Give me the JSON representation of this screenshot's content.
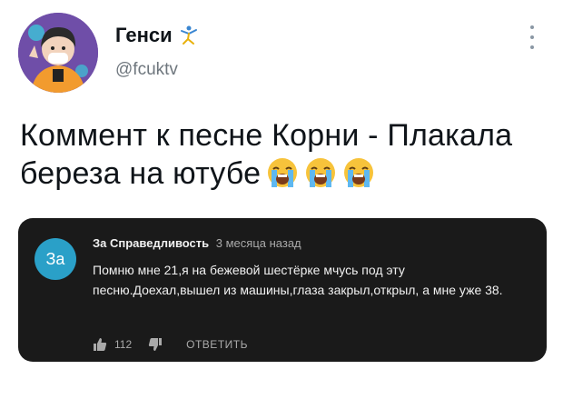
{
  "profile": {
    "display_name": "Генси",
    "handle": "@fcuktv",
    "badge_icon": "dancing-figure-emoji",
    "avatar_colors": {
      "background": "#6f4ea8",
      "hoodie": "#f29b2e",
      "hair": "#2b2b2b"
    }
  },
  "tweet": {
    "text": "Коммент к песне Корни - Плакала береза на ютубе",
    "emojis": [
      "loudly-crying-face",
      "loudly-crying-face",
      "loudly-crying-face"
    ]
  },
  "comment": {
    "avatar_text": "За",
    "avatar_color": "#2aa0c8",
    "author": "За Справедливость",
    "time": "3 месяца назад",
    "body": "Помню мне 21,я на бежевой шестёрке мчусь под эту песню.Доехал,вышел из машины,глаза закрыл,открыл, а мне уже 38.",
    "like_count": "112",
    "reply_label": "ОТВЕТИТЬ",
    "card_background": "#1a1a1a"
  },
  "icons": {
    "more": "more-vertical-icon",
    "like": "thumbs-up-icon",
    "dislike": "thumbs-down-icon"
  }
}
